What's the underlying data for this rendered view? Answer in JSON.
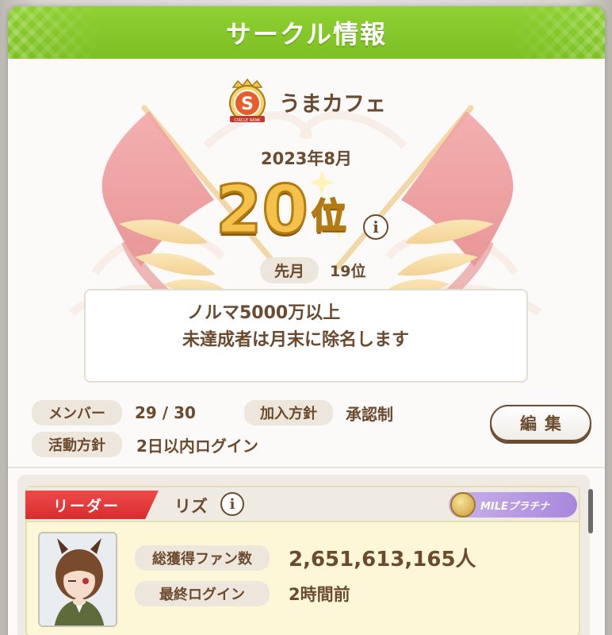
{
  "header": {
    "title": "サークル情報"
  },
  "circle": {
    "rank_badge": "S",
    "rank_badge_caption": "CIRCLE RANK",
    "name": "うまカフェ",
    "month": "2023年8月",
    "rank_number": "20",
    "rank_suffix": "位",
    "prev_label": "先月",
    "prev_value": "19位",
    "description_line1": "ノルマ5000万以上",
    "description_line2": "未達成者は月末に除名します"
  },
  "stats": {
    "members_label": "メンバー",
    "members_value": "29 / 30",
    "join_policy_label": "加入方針",
    "join_policy_value": "承認制",
    "activity_label": "活動方針",
    "activity_value": "2日以内ログイン"
  },
  "edit_button": {
    "label": "編集"
  },
  "leader": {
    "role_label": "リーダー",
    "name": "リズ",
    "class_label": "MILEプラチナ",
    "fans_label": "総獲得ファン数",
    "fans_value": "2,651,613,165人",
    "last_login_label": "最終ログイン",
    "last_login_value": "2時間前"
  },
  "colors": {
    "header_green": "#8fd032",
    "text_brown": "#6b4a2e",
    "gold": "#f4c24a",
    "leader_red": "#e03a3a",
    "class_purple": "#b89be4"
  },
  "icons": [
    "info-icon",
    "rank-s-badge-icon",
    "medal-icon",
    "flag-icon"
  ]
}
